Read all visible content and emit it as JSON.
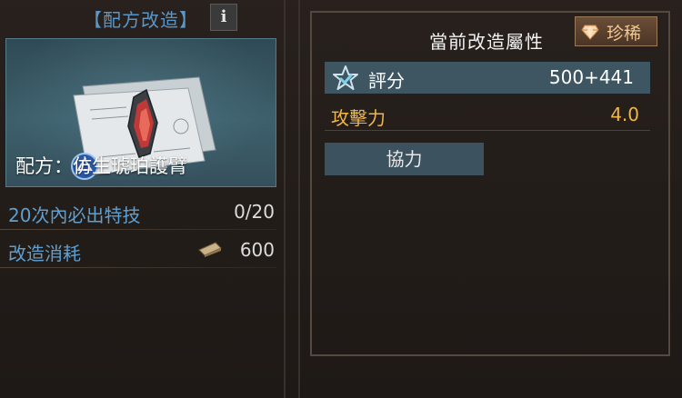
{
  "recipe_panel": {
    "title": "【配方改造】",
    "info_button": "i",
    "recipe_name": "配方：仿生琥珀護臂",
    "guarantee_label": "20次內必出特技",
    "guarantee_progress": "0/20",
    "cost_label": "改造消耗",
    "cost_value": "600",
    "cost_icon": "book-icon"
  },
  "attributes_panel": {
    "title": "當前改造屬性",
    "rarity": {
      "label": "珍稀",
      "icon": "gem-icon"
    },
    "score": {
      "icon": "star-check-icon",
      "label": "評分",
      "value": "500+441"
    },
    "attack": {
      "label": "攻擊力",
      "value": "4.0"
    },
    "synergy_button": "協力"
  },
  "colors": {
    "blue_text": "#5f9fd0",
    "gold_text": "#f0b64a",
    "rarity_text": "#f2c890"
  }
}
